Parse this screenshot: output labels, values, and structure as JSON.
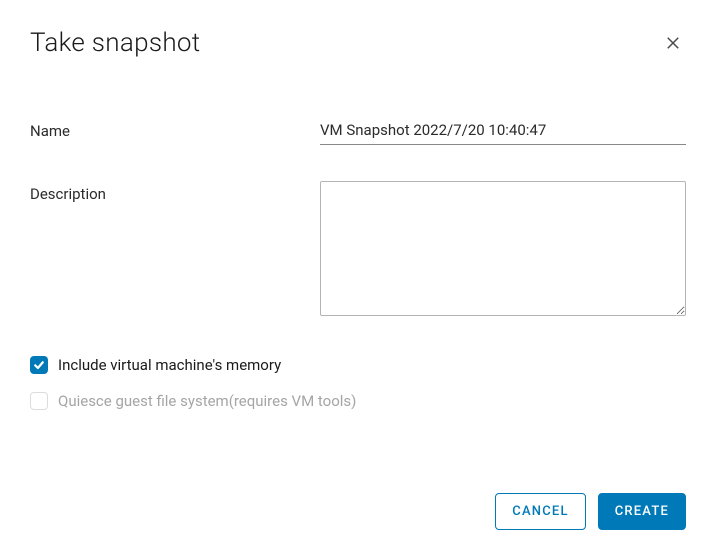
{
  "dialog": {
    "title": "Take snapshot"
  },
  "form": {
    "name_label": "Name",
    "name_value": "VM Snapshot 2022/7/20 10:40:47",
    "description_label": "Description",
    "description_value": ""
  },
  "options": {
    "include_memory": {
      "label": "Include virtual machine's memory",
      "checked": true
    },
    "quiesce": {
      "label": "Quiesce guest file system(requires VM tools)",
      "checked": false,
      "disabled": true
    }
  },
  "footer": {
    "cancel_label": "CANCEL",
    "create_label": "CREATE"
  },
  "colors": {
    "primary": "#0079b8"
  }
}
